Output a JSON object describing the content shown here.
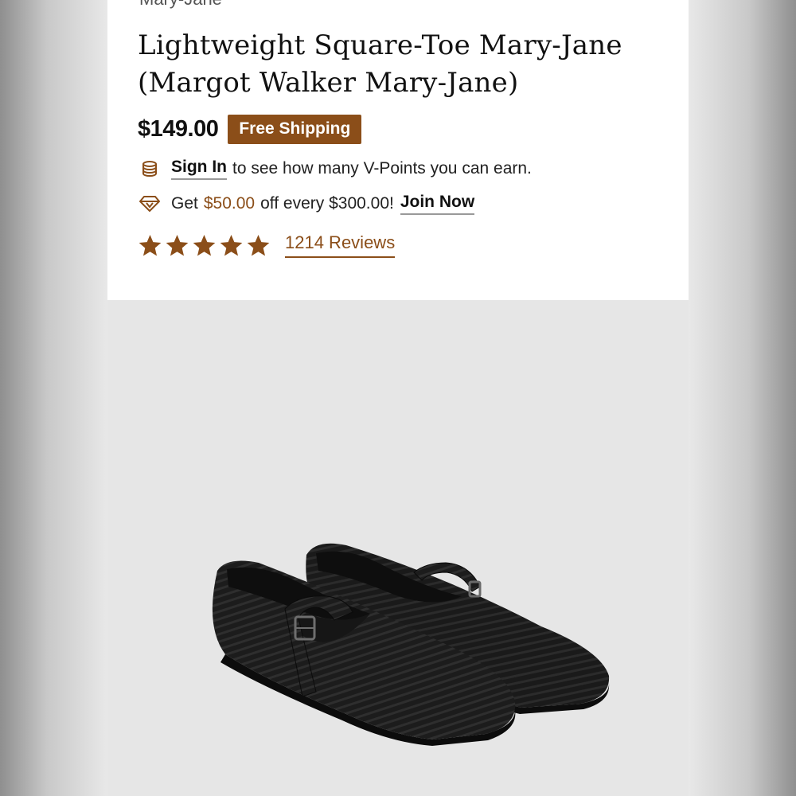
{
  "product": {
    "breadcrumb": "Mary-Jane",
    "title": "Lightweight Square-Toe Mary-Jane (Margot Walker Mary-Jane)",
    "price": "$149.00",
    "shipping_badge": "Free Shipping"
  },
  "points": {
    "sign_in_link": "Sign In",
    "sign_in_text": "to see how many V-Points you can earn.",
    "offer_prefix": "Get",
    "offer_amount": "$50.00",
    "offer_text": "off every $300.00!",
    "join_link": "Join Now"
  },
  "rating": {
    "stars": 5,
    "reviews_link": "1214 Reviews"
  },
  "icons": {
    "points": "coin-stack-icon",
    "offer": "diamond-icon",
    "star": "star-icon"
  },
  "colors": {
    "accent": "#8b4e19",
    "text": "#111111",
    "photo_bg": "#e6e6e6"
  }
}
